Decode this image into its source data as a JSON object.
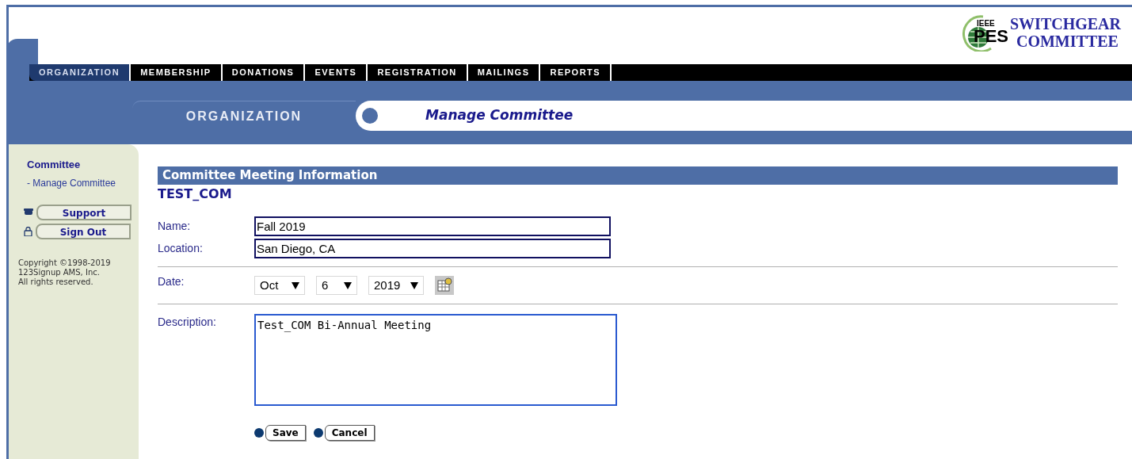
{
  "logo": {
    "small": "IEEE",
    "mark": "PES",
    "line1": "SWITCHGEAR",
    "line2": "COMMITTEE"
  },
  "nav": [
    {
      "label": "ORGANIZATION",
      "selected": true
    },
    {
      "label": "MEMBERSHIP",
      "selected": false
    },
    {
      "label": "DONATIONS",
      "selected": false
    },
    {
      "label": "EVENTS",
      "selected": false
    },
    {
      "label": "REGISTRATION",
      "selected": false
    },
    {
      "label": "MAILINGS",
      "selected": false
    },
    {
      "label": "REPORTS",
      "selected": false
    }
  ],
  "section_tab": "ORGANIZATION",
  "page_title": "Manage Committee",
  "sidebar": {
    "heading": "Committee",
    "items": [
      {
        "label": "- Manage Committee",
        "selected": false
      }
    ],
    "buttons": [
      {
        "kind": "support",
        "label": "Support"
      },
      {
        "kind": "signout",
        "label": "Sign Out"
      }
    ],
    "copyright": [
      "Copyright ©1998-2019",
      "123Signup AMS, Inc.",
      "All rights reserved."
    ]
  },
  "form": {
    "title": "Committee Meeting Information",
    "committee": "TEST_COM",
    "name": {
      "label": "Name:",
      "value": "Fall 2019"
    },
    "location": {
      "label": "Location:",
      "value": "San Diego, CA"
    },
    "date": {
      "label": "Date:",
      "month": "Oct",
      "day": "6",
      "year": "2019"
    },
    "description": {
      "label": "Description:",
      "value": "Test_COM Bi-Annual Meeting"
    },
    "buttons": [
      "Save",
      "Cancel"
    ]
  }
}
